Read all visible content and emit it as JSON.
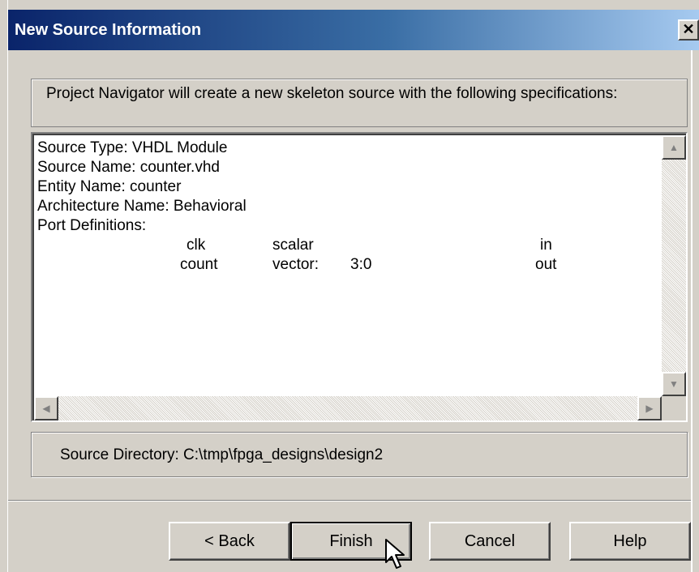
{
  "window": {
    "title": "New Source Information",
    "close_glyph": "✕"
  },
  "info": {
    "text": "Project Navigator will create a new skeleton source with the following specifications:"
  },
  "spec": {
    "source_type": "Source Type:  VHDL Module",
    "source_name": "Source Name:  counter.vhd",
    "entity_name": "Entity Name:  counter",
    "architecture_name": "Architecture Name:  Behavioral",
    "port_definitions": "Port Definitions:",
    "ports": [
      {
        "name": "clk",
        "kind": "scalar",
        "range": "",
        "direction": "in"
      },
      {
        "name": "count",
        "kind": "vector:",
        "range": "3:0",
        "direction": "out"
      }
    ]
  },
  "scrollbar": {
    "up_glyph": "▲",
    "down_glyph": "▼",
    "left_glyph": "◀",
    "right_glyph": "▶"
  },
  "directory": {
    "text": "Source Directory:  C:\\tmp\\fpga_designs\\design2"
  },
  "buttons": {
    "back": "< Back",
    "finish": "Finish",
    "cancel": "Cancel",
    "help": "Help"
  },
  "colors": {
    "title_bar_start": "#0a246a",
    "title_bar_end": "#a6caf0",
    "face": "#d4d0c8"
  },
  "icons": {
    "cursor": "mouse-pointer-icon"
  }
}
